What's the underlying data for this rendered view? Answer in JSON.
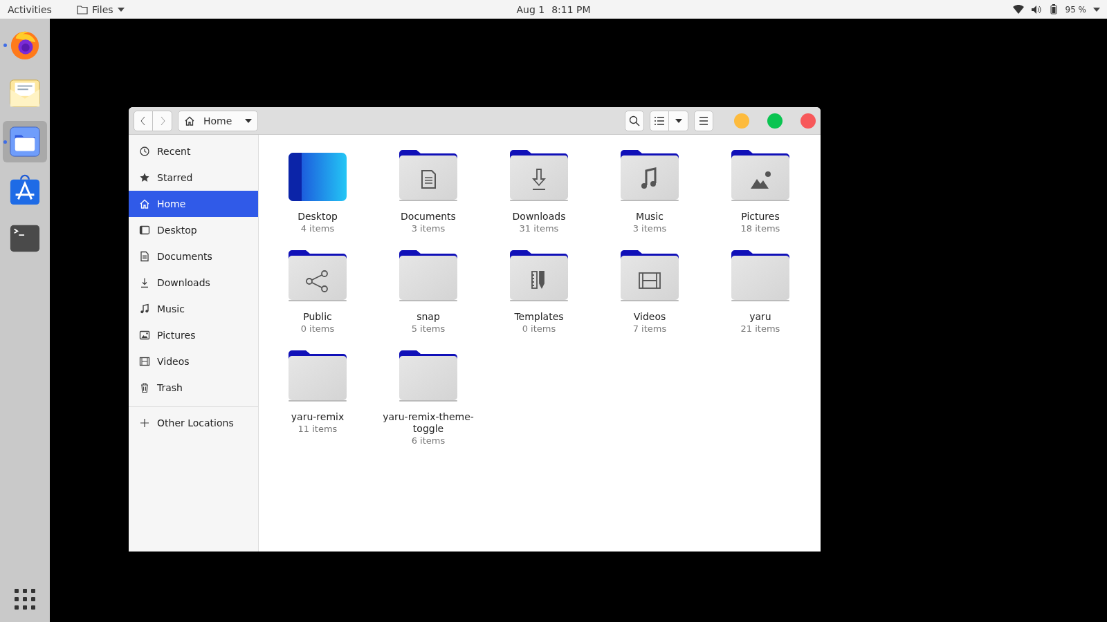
{
  "top_bar": {
    "activities": "Activities",
    "app_menu": "Files",
    "date": "Aug 1",
    "time": "8:11 PM",
    "battery": "95 %"
  },
  "dock": [
    {
      "kind": "browser",
      "running": true,
      "selected": false
    },
    {
      "kind": "mail",
      "running": false,
      "selected": false
    },
    {
      "kind": "files",
      "running": true,
      "selected": true
    },
    {
      "kind": "store",
      "running": false,
      "selected": false
    },
    {
      "kind": "terminal",
      "running": false,
      "selected": false
    }
  ],
  "window": {
    "path": "Home"
  },
  "sidebar": {
    "items": [
      {
        "kind": "recent",
        "label": "Recent",
        "selected": false
      },
      {
        "kind": "starred",
        "label": "Starred",
        "selected": false
      },
      {
        "kind": "home",
        "label": "Home",
        "selected": true
      },
      {
        "kind": "desktop",
        "label": "Desktop",
        "selected": false
      },
      {
        "kind": "documents",
        "label": "Documents",
        "selected": false
      },
      {
        "kind": "downloads",
        "label": "Downloads",
        "selected": false
      },
      {
        "kind": "music",
        "label": "Music",
        "selected": false
      },
      {
        "kind": "pictures",
        "label": "Pictures",
        "selected": false
      },
      {
        "kind": "videos",
        "label": "Videos",
        "selected": false
      },
      {
        "kind": "trash",
        "label": "Trash",
        "selected": false
      }
    ],
    "other": {
      "label": "Other Locations"
    }
  },
  "folders": [
    {
      "kind": "desktop",
      "name": "Desktop",
      "count": "4 items"
    },
    {
      "kind": "documents",
      "name": "Documents",
      "count": "3 items"
    },
    {
      "kind": "downloads",
      "name": "Downloads",
      "count": "31 items"
    },
    {
      "kind": "music",
      "name": "Music",
      "count": "3 items"
    },
    {
      "kind": "pictures",
      "name": "Pictures",
      "count": "18 items"
    },
    {
      "kind": "public",
      "name": "Public",
      "count": "0 items"
    },
    {
      "kind": "plain",
      "name": "snap",
      "count": "5 items"
    },
    {
      "kind": "templates",
      "name": "Templates",
      "count": "0 items"
    },
    {
      "kind": "videos",
      "name": "Videos",
      "count": "7 items"
    },
    {
      "kind": "plain",
      "name": "yaru",
      "count": "21 items"
    },
    {
      "kind": "plain",
      "name": "yaru-remix",
      "count": "11 items"
    },
    {
      "kind": "plain",
      "name": "yaru-remix-theme-toggle",
      "count": "6 items"
    }
  ]
}
